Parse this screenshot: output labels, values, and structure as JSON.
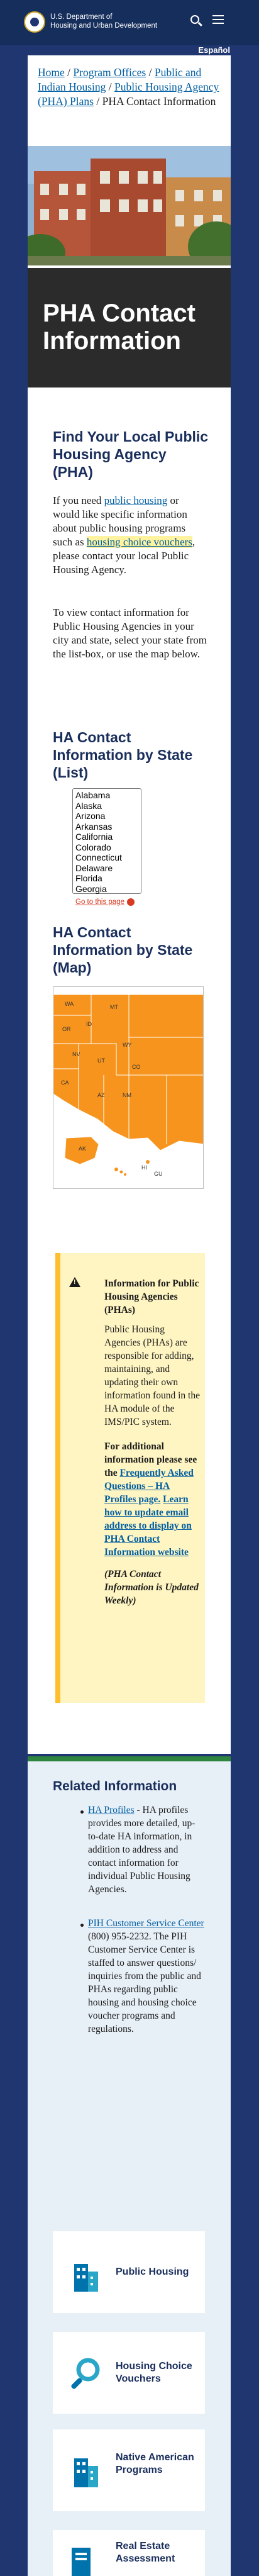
{
  "header": {
    "agency_line1": "U.S. Department of",
    "agency_line2": "Housing and Urban Development",
    "language_link": "Español"
  },
  "breadcrumb": {
    "home": "Home",
    "sep1": " / ",
    "program_offices": "Program Offices",
    "sep2": " / ",
    "public_indian_housing": "Public and Indian Housing",
    "sep3": " / ",
    "pha_plans": "Public Housing Agency (PHA) Plans",
    "sep4": " / ",
    "current": "PHA Contact Information"
  },
  "page_title": "PHA Contact Information",
  "find_section": {
    "heading": "Find Your Local Public Housing Agency (PHA)",
    "p1_before": "If you need ",
    "p1_link1": "public housing",
    "p1_mid": " or would like specific information about public housing programs such as ",
    "p1_link2": "housing choice vouchers",
    "p1_after": ", please contact your local Public Housing Agency.",
    "p2": "To view contact information for Public Housing Agencies in your city and state, select your state from the list-box, or use the map below."
  },
  "state_list": {
    "heading": "HA Contact Information by State (List)",
    "options": [
      "Alabama",
      "Alaska",
      "Arizona",
      "Arkansas",
      "California",
      "Colorado",
      "Connecticut",
      "Delaware",
      "Florida",
      "Georgia"
    ],
    "top_link": "Go to this page"
  },
  "state_map": {
    "heading": "HA Contact Information by State (Map)",
    "labels": [
      "WA",
      "OR",
      "ID",
      "MT",
      "NV",
      "CA",
      "UT",
      "WY",
      "CO",
      "AZ",
      "NM",
      "AK",
      "HI",
      "GU"
    ],
    "fill_color": "#f7941d"
  },
  "alert": {
    "title": "Information for Public Housing Agencies (PHAs)",
    "body": "Public Housing Agencies (PHAs) are responsible for adding, maintaining, and updating their own information found in the HA module of the IMS/PIC system.",
    "additional": "For additional information please see the ",
    "faq_link": "Frequently Asked Questions – HA Profiles page.",
    "learn_link": "Learn how to update email address to display on PHA Contact Information website",
    "weekly": "(PHA Contact Information is Updated Weekly)"
  },
  "related": {
    "heading": "Related Information",
    "item1_link": "HA Profiles",
    "item1_text": " - HA profiles provides more detailed, up-to-date HA information, in addition to address and contact information for individual Public Housing Agencies.",
    "item2_link": "PIH Customer Service Center",
    "item2_text": " (800) 955-2232. The PIH Customer Service Center is staffed to answer questions/ inquiries from the public and PHAs regarding public housing and housing choice voucher programs and regulations."
  },
  "cards": [
    {
      "label": "Public Housing",
      "icon": "buildings-icon"
    },
    {
      "label": "Housing Choice Vouchers",
      "icon": "magnifier-icon"
    },
    {
      "label": "Native American Programs",
      "icon": "buildings-icon"
    },
    {
      "label": "Real Estate Assessment",
      "icon": "document-icon"
    }
  ],
  "colors": {
    "navy": "#1f3670",
    "link": "#005ea2",
    "green": "#2e8540",
    "alert": "#fff5c2",
    "orange": "#f7941d"
  }
}
